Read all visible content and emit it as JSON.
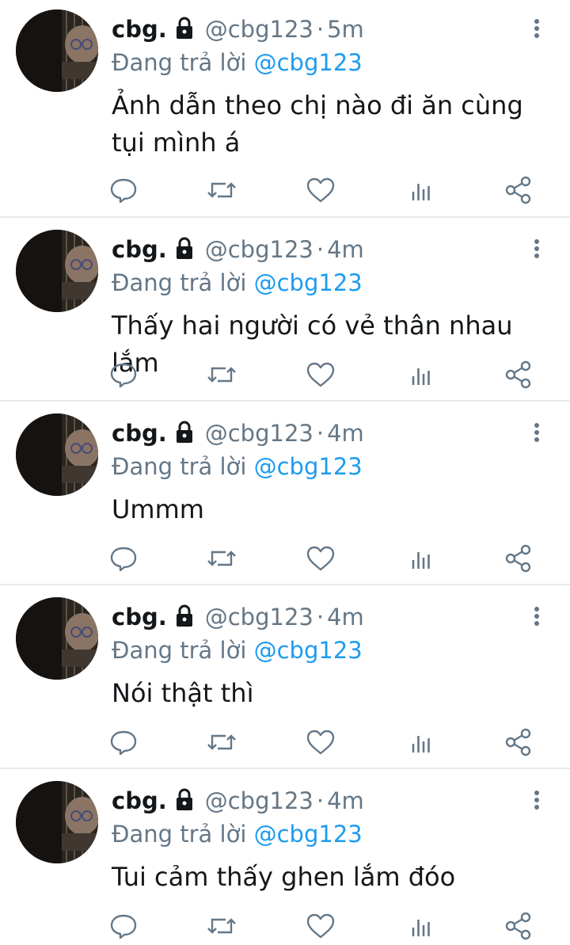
{
  "tweets": [
    {
      "name": "cbg.",
      "handle": "@cbg123",
      "separator": "·",
      "time": "5m",
      "reply_prefix": "Đang trả lời",
      "reply_to": "@cbg123",
      "text": "Ảnh dẫn theo chị nào đi ăn cùng tụi mình á"
    },
    {
      "name": "cbg.",
      "handle": "@cbg123",
      "separator": "·",
      "time": "4m",
      "reply_prefix": "Đang trả lời",
      "reply_to": "@cbg123",
      "text": "Thấy hai người có vẻ thân nhau lắm"
    },
    {
      "name": "cbg.",
      "handle": "@cbg123",
      "separator": "·",
      "time": "4m",
      "reply_prefix": "Đang trả lời",
      "reply_to": "@cbg123",
      "text": "Ummm"
    },
    {
      "name": "cbg.",
      "handle": "@cbg123",
      "separator": "·",
      "time": "4m",
      "reply_prefix": "Đang trả lời",
      "reply_to": "@cbg123",
      "text": "Nói thật thì"
    },
    {
      "name": "cbg.",
      "handle": "@cbg123",
      "separator": "·",
      "time": "4m",
      "reply_prefix": "Đang trả lời",
      "reply_to": "@cbg123",
      "text": "Tui cảm thấy ghen lắm đóo"
    }
  ],
  "icons": {
    "lock": "lock-icon",
    "more": "more-vertical-icon",
    "reply": "reply-icon",
    "retweet": "retweet-icon",
    "like": "heart-icon",
    "stats": "analytics-icon",
    "share": "share-icon"
  },
  "colors": {
    "mention": "#1d9bf0",
    "secondary_text": "#657786",
    "icon": "#657786",
    "divider": "#e8ecef"
  }
}
